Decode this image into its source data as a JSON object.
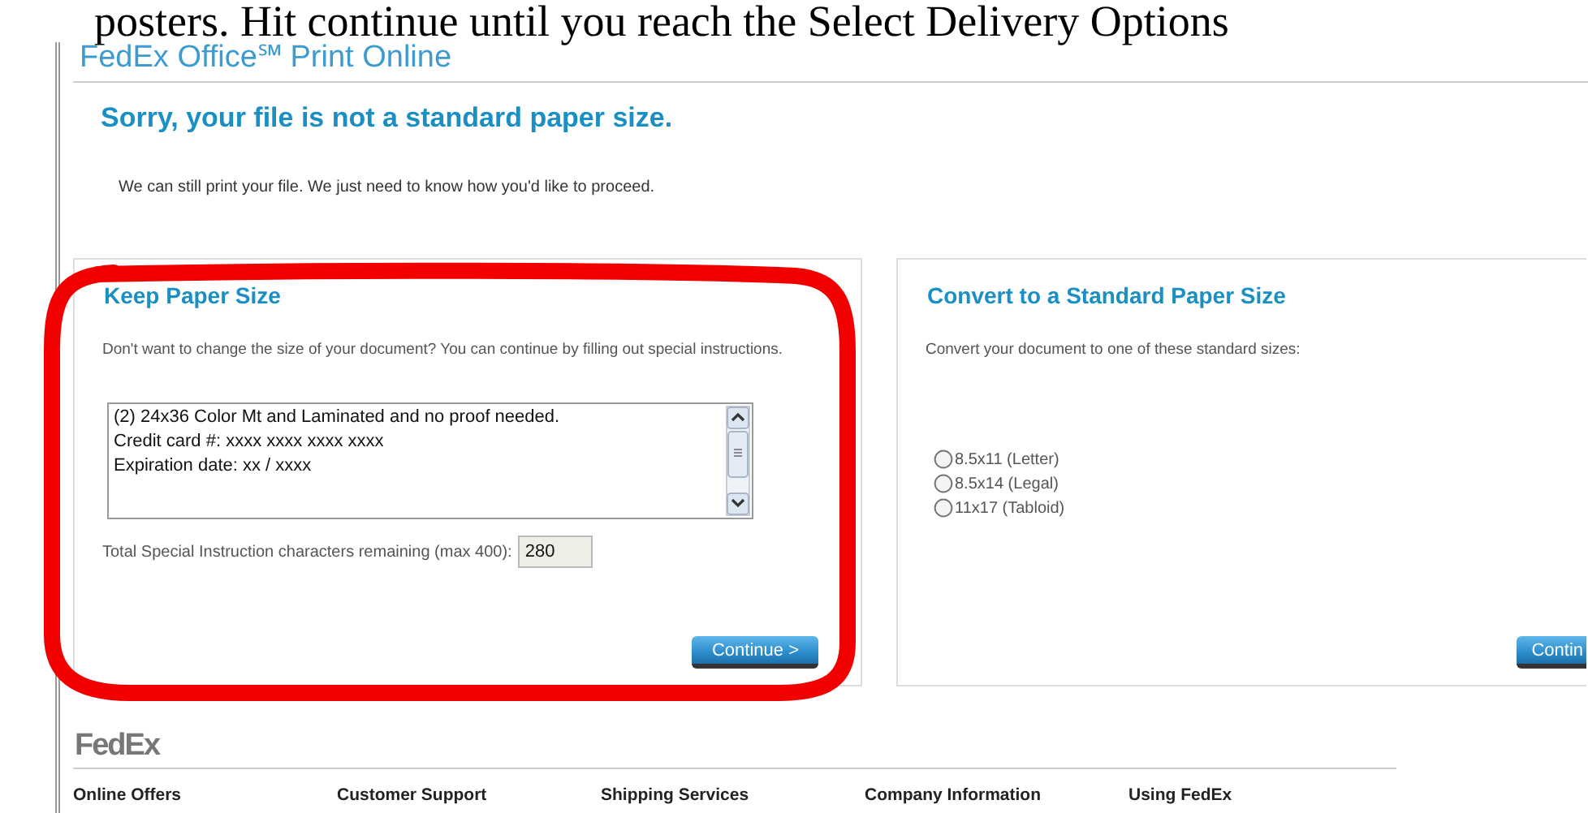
{
  "document_text": "posters.  Hit continue until you reach the Select Delivery Options",
  "site_title": "FedEx Office℠ Print Online",
  "heading": "Sorry, your file is not a standard paper size.",
  "intro": "We can still print your file. We just need to know how you'd like to proceed.",
  "keep_panel": {
    "title": "Keep Paper Size",
    "description": "Don't want to change the size of your document? You can continue by filling out special instructions.",
    "instructions": {
      "value": [
        "(2) 24x36 Color Mt and Laminated and no proof needed.",
        "Credit card #: xxxx xxxx xxxx xxxx",
        "Expiration date:  xx / xxxx"
      ]
    },
    "counter_label": "Total Special Instruction characters remaining (max 400):",
    "counter_value": "280",
    "button": "Continue >"
  },
  "convert_panel": {
    "title": "Convert to a Standard Paper Size",
    "description": "Convert your document to one of these standard sizes:",
    "options": [
      {
        "label": "8.5x11 (Letter)",
        "selected": false
      },
      {
        "label": "8.5x14 (Legal)",
        "selected": false
      },
      {
        "label": "11x17 (Tabloid)",
        "selected": false
      }
    ],
    "button": "Contin"
  },
  "footer": {
    "logo": "FedEx",
    "columns": [
      "Online Offers",
      "Customer Support",
      "Shipping Services",
      "Company Information",
      "Using FedEx"
    ]
  },
  "annotation": {
    "kind": "loop"
  }
}
